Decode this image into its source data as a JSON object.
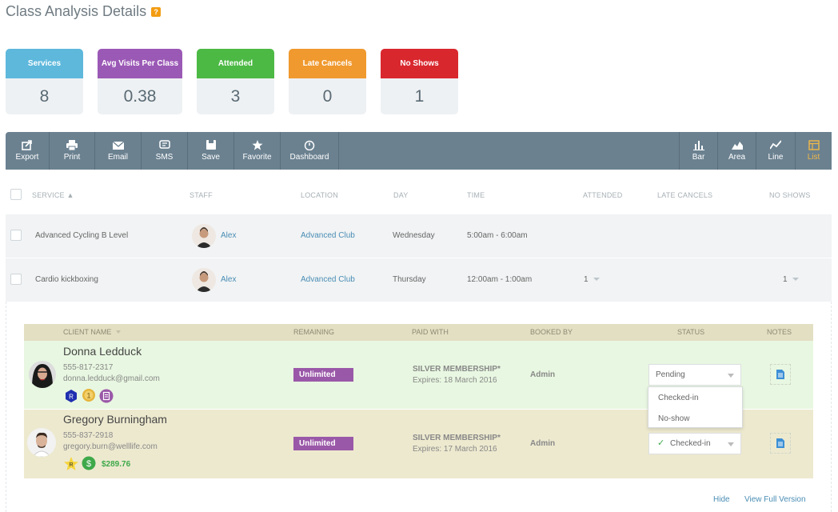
{
  "page": {
    "title": "Class Analysis Details",
    "help_icon": "?"
  },
  "stats": [
    {
      "label": "Services",
      "value": "8",
      "color": "#5db8dc"
    },
    {
      "label": "Avg Visits Per Class",
      "value": "0.38",
      "color": "#9b59b6"
    },
    {
      "label": "Attended",
      "value": "3",
      "color": "#4cb944"
    },
    {
      "label": "Late Cancels",
      "value": "0",
      "color": "#f0992e"
    },
    {
      "label": "No Shows",
      "value": "1",
      "color": "#d9272e"
    }
  ],
  "toolbar": {
    "left": [
      {
        "label": "Export",
        "icon": "export-icon"
      },
      {
        "label": "Print",
        "icon": "print-icon"
      },
      {
        "label": "Email",
        "icon": "email-icon"
      },
      {
        "label": "SMS",
        "icon": "sms-icon"
      },
      {
        "label": "Save",
        "icon": "save-icon"
      },
      {
        "label": "Favorite",
        "icon": "star-icon"
      },
      {
        "label": "Dashboard",
        "icon": "dashboard-icon"
      }
    ],
    "right": [
      {
        "label": "Bar",
        "icon": "bar-chart-icon"
      },
      {
        "label": "Area",
        "icon": "area-chart-icon"
      },
      {
        "label": "Line",
        "icon": "line-chart-icon"
      },
      {
        "label": "List",
        "icon": "list-icon",
        "active": true
      }
    ]
  },
  "table": {
    "headers": {
      "service": "SERVICE ▲",
      "staff": "STAFF",
      "location": "LOCATION",
      "day": "DAY",
      "time": "TIME",
      "attended": "ATTENDED",
      "late_cancels": "LATE CANCELS",
      "no_shows": "NO SHOWS"
    },
    "rows": [
      {
        "service": "Advanced Cycling B Level",
        "staff": "Alex",
        "location": "Advanced Club",
        "day": "Wednesday",
        "time": "5:00am - 6:00am",
        "attended": "",
        "no_shows": ""
      },
      {
        "service": "Cardio kickboxing",
        "staff": "Alex",
        "location": "Advanced Club",
        "day": "Thursday",
        "time": "12:00am - 1:00am",
        "attended": "1",
        "no_shows": "1"
      }
    ]
  },
  "clients": {
    "headers": {
      "client_name": "CLIENT NAME",
      "remaining": "REMAINING",
      "paid_with": "PAID WITH",
      "booked_by": "BOOKED BY",
      "status": "STATUS",
      "notes": "NOTES"
    },
    "rows": [
      {
        "name": "Donna Ledduck",
        "phone": "555-817-2317",
        "email": "donna.ledduck@gmail.com",
        "remaining": "Unlimited",
        "paid_with": "SILVER MEMBERSHIP*",
        "expires": "Expires: 18 March 2016",
        "booked_by": "Admin",
        "status": "Pending",
        "bg": "#e8f7e1",
        "badges": [
          "R",
          "1"
        ]
      },
      {
        "name": "Gregory Burningham",
        "phone": "555-837-2918",
        "email": "gregory.burn@welllife.com",
        "remaining": "Unlimited",
        "paid_with": "SILVER MEMBERSHIP*",
        "expires": "Expires: 17 March 2016",
        "booked_by": "Admin",
        "status": "Checked-in",
        "bg": "#ede9cf",
        "badges": [
          "R",
          "$"
        ],
        "balance": "$289.76"
      }
    ],
    "status_options": [
      "Checked-in",
      "No-show"
    ]
  },
  "footer": {
    "hide": "Hide",
    "full_version": "View Full Version"
  }
}
